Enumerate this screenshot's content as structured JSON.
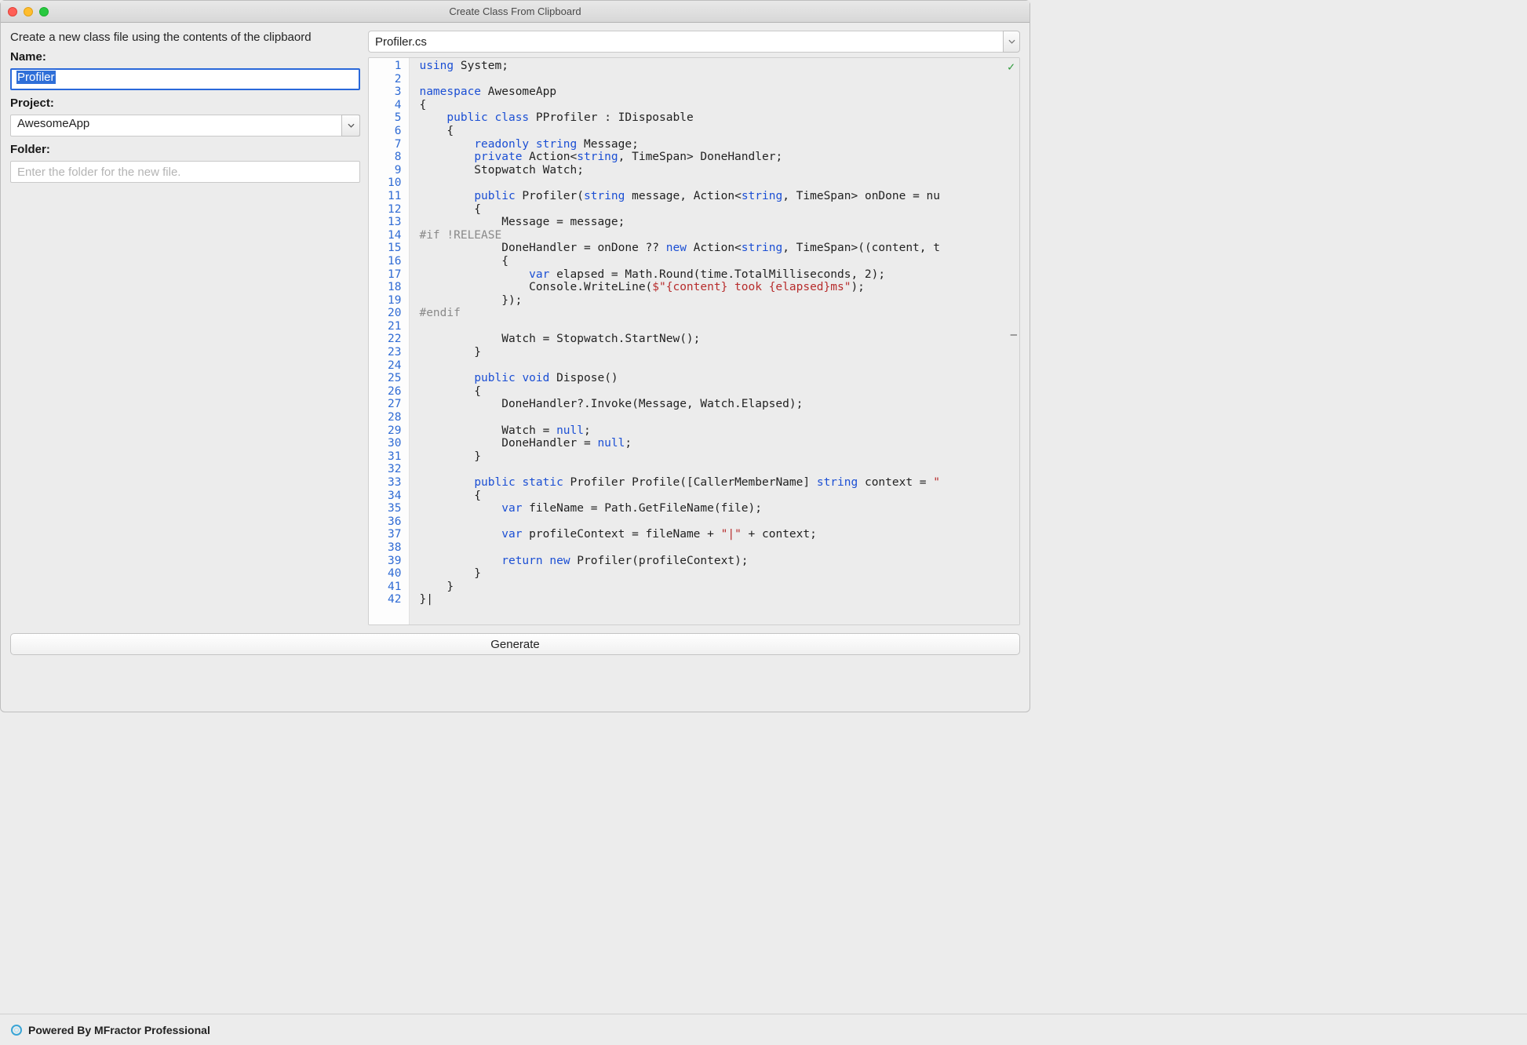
{
  "window": {
    "title": "Create Class From Clipboard"
  },
  "description": "Create a new class file using the contents of the clipbaord",
  "form": {
    "name_label": "Name:",
    "name_value": "Profiler",
    "project_label": "Project:",
    "project_value": "AwesomeApp",
    "folder_label": "Folder:",
    "folder_placeholder": "Enter the folder for the new file."
  },
  "editor": {
    "filename": "Profiler.cs",
    "line_count": 42,
    "lines": [
      "using System;",
      "",
      "namespace AwesomeApp",
      "{",
      "    public class PProfiler : IDisposable",
      "    {",
      "        readonly string Message;",
      "        private Action<string, TimeSpan> DoneHandler;",
      "        Stopwatch Watch;",
      "",
      "        public Profiler(string message, Action<string, TimeSpan> onDone = nu",
      "        {",
      "            Message = message;",
      "#if !RELEASE",
      "            DoneHandler = onDone ?? new Action<string, TimeSpan>((content, t",
      "            {",
      "                var elapsed = Math.Round(time.TotalMilliseconds, 2);",
      "                Console.WriteLine($\"{content} took {elapsed}ms\");",
      "            });",
      "#endif",
      "",
      "            Watch = Stopwatch.StartNew();",
      "        }",
      "",
      "        public void Dispose()",
      "        {",
      "            DoneHandler?.Invoke(Message, Watch.Elapsed);",
      "",
      "            Watch = null;",
      "            DoneHandler = null;",
      "        }",
      "",
      "        public static Profiler Profile([CallerMemberName] string context = \"",
      "        {",
      "            var fileName = Path.GetFileName(file);",
      "",
      "            var profileContext = fileName + \"|\" + context;",
      "",
      "            return new Profiler(profileContext);",
      "        }",
      "    }",
      "}|"
    ]
  },
  "buttons": {
    "generate": "Generate"
  },
  "footer": {
    "powered_by": "Powered By MFractor Professional"
  }
}
